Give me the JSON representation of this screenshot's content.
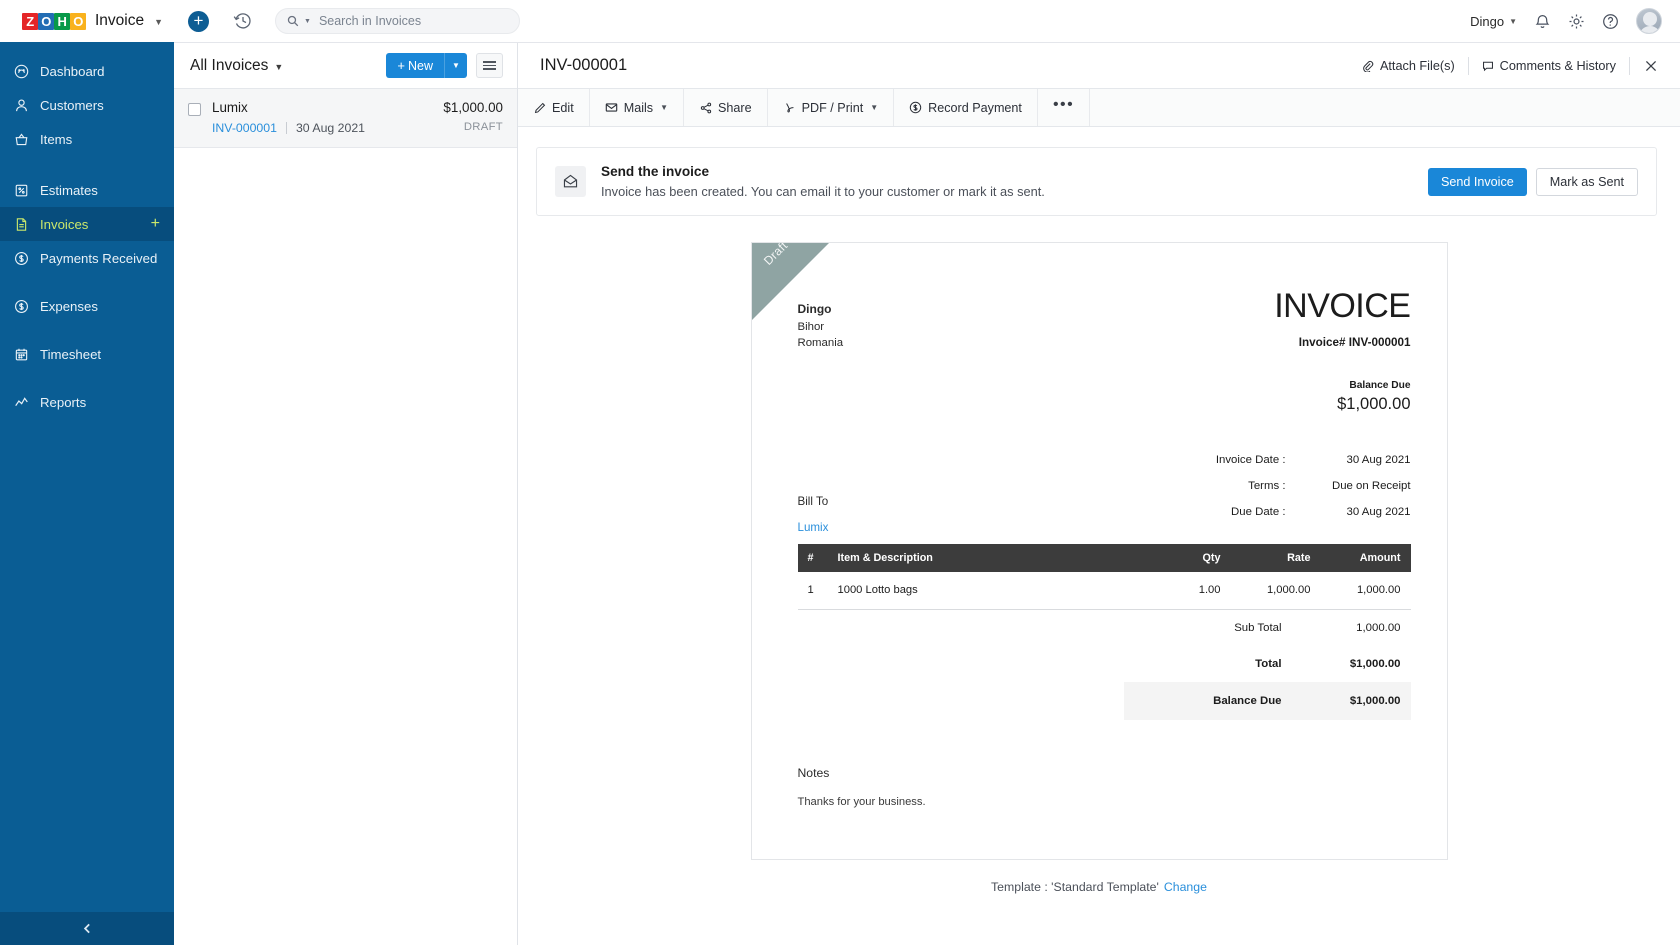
{
  "topbar": {
    "logo_tiles": [
      "Z",
      "O",
      "H",
      "O"
    ],
    "product": "Invoice",
    "add_icon": "plus-icon",
    "history_icon": "clock-history-icon",
    "search": {
      "placeholder": "Search in Invoices",
      "value": "",
      "icon": "search-icon"
    },
    "org": "Dingo",
    "notifications_icon": "bell-icon",
    "settings_icon": "gear-icon",
    "help_icon": "help-icon",
    "avatar": "user-avatar"
  },
  "sidebar": {
    "items": [
      {
        "label": "Dashboard",
        "icon": "dashboard-icon",
        "active": false,
        "add": false
      },
      {
        "label": "Customers",
        "icon": "customers-icon",
        "active": false,
        "add": false
      },
      {
        "label": "Items",
        "icon": "items-basket-icon",
        "active": false,
        "add": false
      },
      {
        "label": "Estimates",
        "icon": "estimates-icon",
        "active": false,
        "add": false
      },
      {
        "label": "Invoices",
        "icon": "invoices-icon",
        "active": true,
        "add": true
      },
      {
        "label": "Payments Received",
        "icon": "payments-icon",
        "active": false,
        "add": false
      },
      {
        "label": "Expenses",
        "icon": "expenses-icon",
        "active": false,
        "add": false
      },
      {
        "label": "Timesheet",
        "icon": "timesheet-icon",
        "active": false,
        "add": false
      },
      {
        "label": "Reports",
        "icon": "reports-icon",
        "active": false,
        "add": false
      }
    ],
    "add_symbol": "+",
    "collapse_icon": "chevron-left-icon"
  },
  "list_panel": {
    "title": "All Invoices",
    "new_label": "New",
    "new_plus": "+",
    "rows": [
      {
        "customer": "Lumix",
        "invoice_no": "INV-000001",
        "date": "30 Aug 2021",
        "amount": "$1,000.00",
        "status": "DRAFT",
        "selected": true
      }
    ]
  },
  "detail": {
    "title": "INV-000001",
    "attach_label": "Attach File(s)",
    "comments_label": "Comments & History",
    "close_icon": "close-icon",
    "toolbar": [
      {
        "label": "Edit",
        "icon": "pencil-icon",
        "caret": false
      },
      {
        "label": "Mails",
        "icon": "mail-icon",
        "caret": true
      },
      {
        "label": "Share",
        "icon": "share-icon",
        "caret": false
      },
      {
        "label": "PDF / Print",
        "icon": "pdf-icon",
        "caret": true
      },
      {
        "label": "Record Payment",
        "icon": "record-payment-icon",
        "caret": false
      }
    ],
    "more_label": "•••"
  },
  "banner": {
    "icon": "envelope-open-icon",
    "title": "Send the invoice",
    "description": "Invoice has been created. You can email it to your customer or mark it as sent.",
    "primary_button": "Send Invoice",
    "secondary_button": "Mark as Sent"
  },
  "invoice": {
    "ribbon": "Draft",
    "from": {
      "company": "Dingo",
      "line1": "Bihor",
      "line2": "Romania"
    },
    "heading": "INVOICE",
    "invoice_no_label": "Invoice# INV-000001",
    "balance_due_label": "Balance Due",
    "balance_due_value": "$1,000.00",
    "bill_to_label": "Bill To",
    "bill_to_name": "Lumix",
    "meta": [
      {
        "label": "Invoice Date :",
        "value": "30 Aug 2021"
      },
      {
        "label": "Terms :",
        "value": "Due on Receipt"
      },
      {
        "label": "Due Date :",
        "value": "30 Aug 2021"
      }
    ],
    "table": {
      "columns": [
        "#",
        "Item & Description",
        "Qty",
        "Rate",
        "Amount"
      ],
      "rows": [
        {
          "num": "1",
          "description": "1000 Lotto bags",
          "qty": "1.00",
          "rate": "1,000.00",
          "amount": "1,000.00"
        }
      ]
    },
    "totals": [
      {
        "label": "Sub Total",
        "value": "1,000.00",
        "bold": false,
        "highlight": false
      },
      {
        "label": "Total",
        "value": "$1,000.00",
        "bold": true,
        "highlight": false
      },
      {
        "label": "Balance Due",
        "value": "$1,000.00",
        "bold": true,
        "highlight": true
      }
    ],
    "notes_label": "Notes",
    "notes_text": "Thanks for your business."
  },
  "footer": {
    "template_text": "Template : 'Standard Template'",
    "change_link": "Change"
  },
  "colors": {
    "sidebar_bg": "#0a5d94",
    "sidebar_active_bg": "#074d7d",
    "sidebar_active_text": "#cbe86b",
    "accent_blue": "#1a87d8",
    "link_blue": "#2a8fdb",
    "table_header_bg": "#3c3c3c",
    "ribbon_bg": "#8fa4a3",
    "balance_row_bg": "#f4f4f4",
    "list_row_selected": "#f5f6f7"
  }
}
